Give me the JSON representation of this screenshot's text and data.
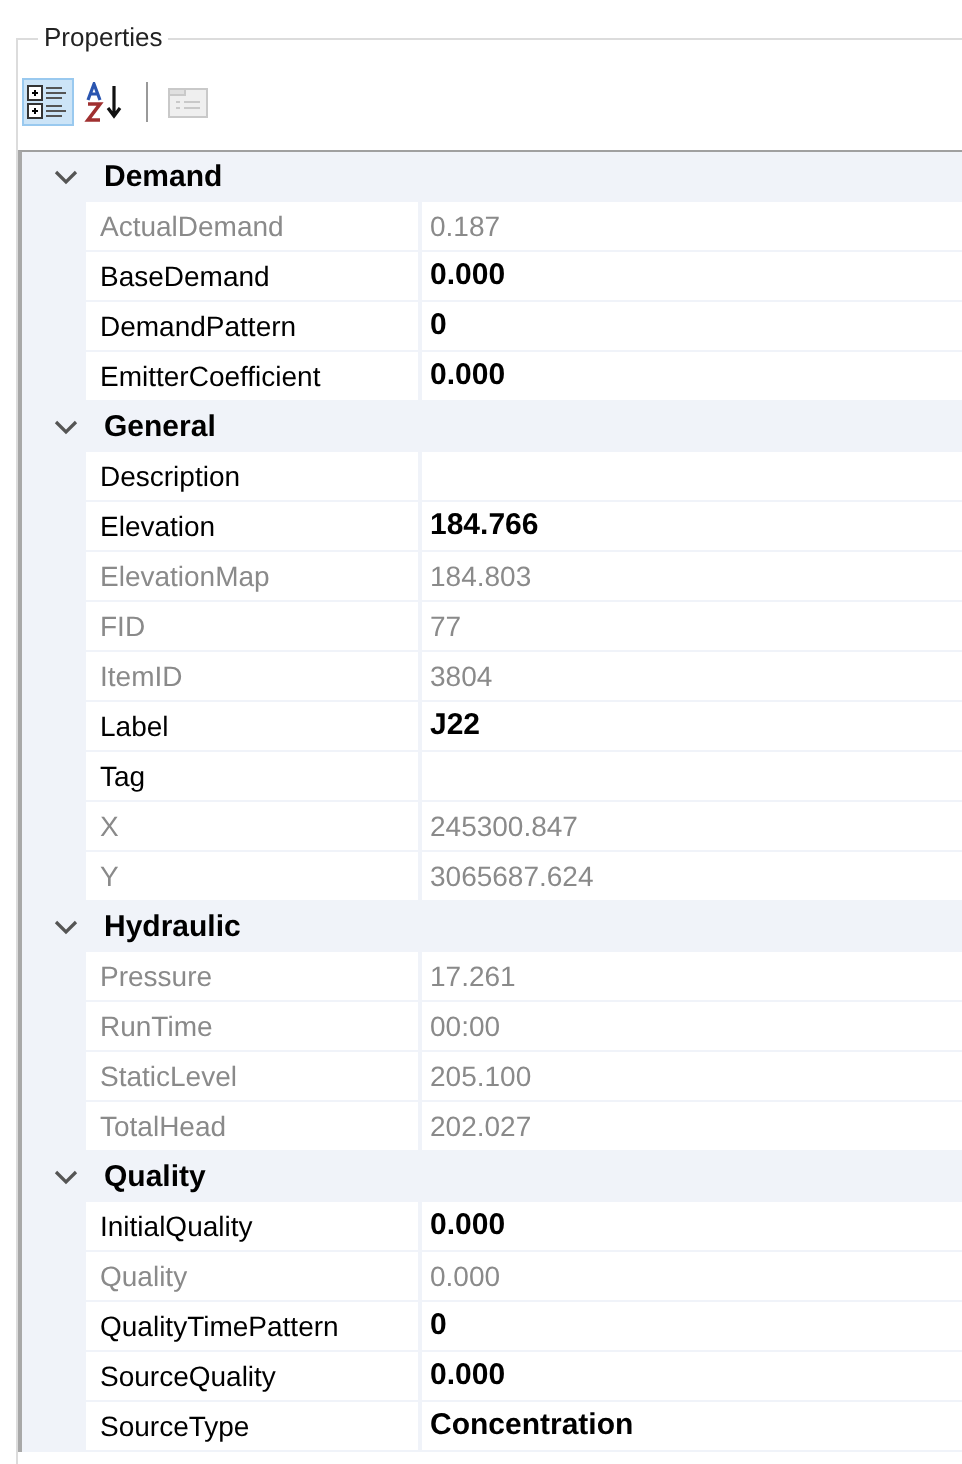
{
  "panel": {
    "title": "Properties"
  },
  "toolbar": [
    {
      "kind": "categorized",
      "selected": true,
      "disabled": false
    },
    {
      "kind": "alphabetical",
      "selected": false,
      "disabled": false
    },
    {
      "kind": "separator"
    },
    {
      "kind": "pages",
      "selected": false,
      "disabled": true
    }
  ],
  "categories": [
    {
      "name": "Demand",
      "expanded": true,
      "properties": [
        {
          "name": "ActualDemand",
          "value": "0.187",
          "readonly": true,
          "bold": false
        },
        {
          "name": "BaseDemand",
          "value": "0.000",
          "readonly": false,
          "bold": true
        },
        {
          "name": "DemandPattern",
          "value": "0",
          "readonly": false,
          "bold": true
        },
        {
          "name": "EmitterCoefficient",
          "value": "0.000",
          "readonly": false,
          "bold": true
        }
      ]
    },
    {
      "name": "General",
      "expanded": true,
      "properties": [
        {
          "name": "Description",
          "readonly": false
        },
        {
          "name": "Elevation",
          "value": "184.766",
          "readonly": false,
          "bold": true
        },
        {
          "name": "ElevationMap",
          "value": "184.803",
          "readonly": true,
          "bold": false
        },
        {
          "name": "FID",
          "value": "77",
          "readonly": true,
          "bold": false
        },
        {
          "name": "ItemID",
          "value": "3804",
          "readonly": true,
          "bold": false
        },
        {
          "name": "Label",
          "value": "J22",
          "readonly": false,
          "bold": true
        },
        {
          "name": "Tag",
          "readonly": false
        },
        {
          "name": "X",
          "value": "245300.847",
          "readonly": true,
          "bold": false
        },
        {
          "name": "Y",
          "value": "3065687.624",
          "readonly": true,
          "bold": false
        }
      ]
    },
    {
      "name": "Hydraulic",
      "expanded": true,
      "properties": [
        {
          "name": "Pressure",
          "value": "17.261",
          "readonly": true,
          "bold": false
        },
        {
          "name": "RunTime",
          "value": "00:00",
          "readonly": true,
          "bold": false
        },
        {
          "name": "StaticLevel",
          "value": "205.100",
          "readonly": true,
          "bold": false
        },
        {
          "name": "TotalHead",
          "value": "202.027",
          "readonly": true,
          "bold": false
        }
      ]
    },
    {
      "name": "Quality",
      "expanded": true,
      "properties": [
        {
          "name": "InitialQuality",
          "value": "0.000",
          "readonly": false,
          "bold": true
        },
        {
          "name": "Quality",
          "value": "0.000",
          "readonly": true,
          "bold": false
        },
        {
          "name": "QualityTimePattern",
          "value": "0",
          "readonly": false,
          "bold": true
        },
        {
          "name": "SourceQuality",
          "value": "0.000",
          "readonly": false,
          "bold": true
        },
        {
          "name": "SourceType",
          "value": "Concentration",
          "readonly": false,
          "bold": true
        }
      ]
    }
  ]
}
